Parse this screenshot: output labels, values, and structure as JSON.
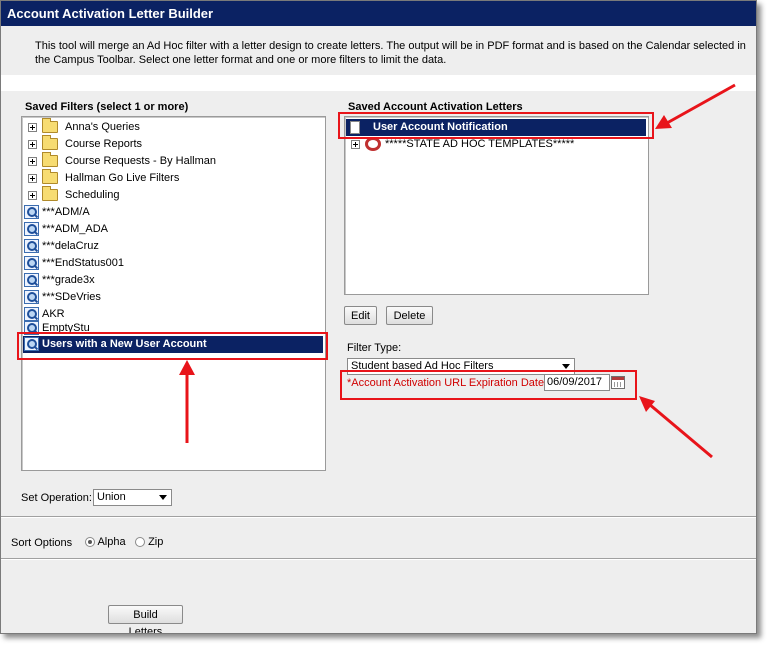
{
  "window": {
    "title": "Account Activation Letter Builder"
  },
  "description": "This tool will merge an Ad Hoc filter with a letter design to create letters. The output will be in PDF format and is based on the Calendar selected in the Campus Toolbar. Select one letter format and one or more filters to limit the data.",
  "saved_filters": {
    "label": "Saved Filters (select 1 or more)",
    "folders": [
      "Anna's Queries",
      "Course Reports",
      "Course Requests - By Hallman",
      "Hallman Go Live Filters",
      "Scheduling"
    ],
    "items": [
      "***ADM/A",
      "***ADM_ADA",
      "***delaCruz",
      "***EndStatus001",
      "***grade3x",
      "***SDeVries",
      "AKR",
      "EmptyStu",
      "Users with a New User Account"
    ],
    "selected": "Users with a New User Account"
  },
  "saved_letters": {
    "label": "Saved Account Activation Letters",
    "items": [
      "User Account Notification",
      "*****STATE AD HOC TEMPLATES*****"
    ],
    "selected": "User Account Notification"
  },
  "buttons": {
    "edit": "Edit",
    "delete": "Delete",
    "build": "Build Letters"
  },
  "filter_type": {
    "label": "Filter Type:",
    "value": "Student based Ad Hoc Filters"
  },
  "expiration": {
    "label": "*Account Activation URL Expiration Date:",
    "value": "06/09/2017"
  },
  "set_operation": {
    "label": "Set Operation:",
    "value": "Union"
  },
  "sort_options": {
    "label": "Sort Options",
    "alpha": "Alpha",
    "zip": "Zip",
    "selected": "Alpha"
  },
  "colors": {
    "title_bg": "#0b2263",
    "highlight": "#e8141a",
    "required": "#d00000"
  }
}
